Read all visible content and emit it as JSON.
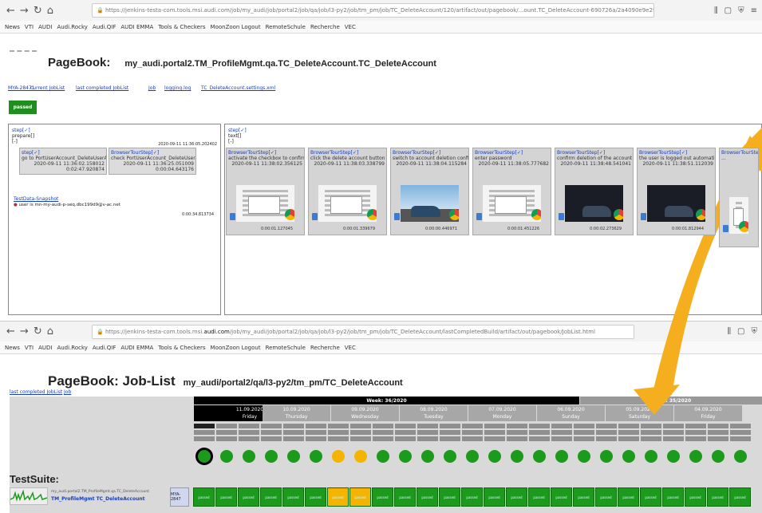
{
  "browser1": {
    "url": "https://jenkins-testa-com.tools.msi.audi.com/job/my_audi/job/portal2/job/qa/job/l3-py2/job/tm_pm/job/TC_DeleteAccount/120/artifact/out/pagebook/...ount.TC_DeleteAccount-690726a/2a4090e9e29a1"
  },
  "browser2": {
    "url_pre": "https://jenkins-testa-com.tools.msi.",
    "url_host": "audi.com",
    "url_post": "/job/my_audi/job/portal2/job/qa/job/l3-py2/job/tm_pm/job/TC_DeleteAccount/lastCompletedBuild/artifact/out/pagebook/JobList.html"
  },
  "bookmarks": [
    "News",
    "VTI",
    "AUDI",
    "Audi.Rocky",
    "Audi.QIF",
    "AUDI EMMA",
    "Tools & Checkers",
    "MoonZoon Logout",
    "RemoteSchule",
    "Recherche",
    "VEC"
  ],
  "page1": {
    "title": "PageBook:",
    "subtitle": "my_audi.portal2.TM_ProfileMgmt.qa.TC_DeleteAccount.TC_DeleteAccount",
    "links": [
      "MYA-28471",
      "current JobList",
      "last completed JobList",
      "Job",
      "logging.log",
      "TC_DeleteAccount.settings.xml"
    ],
    "status": "passed",
    "left": {
      "step": "step[✓]",
      "prepare": "prepare[]",
      "bracket": "[-]",
      "time": "2020-09-11 11:36:05.202402",
      "sub": [
        {
          "h": "step[✓]",
          "t": "go to PortUserAccount_DeleteUserAccount",
          "ts": "2020-09-11 11:36:02.158012",
          "d": "0:02:47.920874"
        },
        {
          "h": "BrowserTourStep[✓]",
          "t": "check PortUserAccount_DeleteUserAccount",
          "ts": "2020-09-11 11:36:25.051009",
          "d": "0:00:04.643176"
        }
      ],
      "testdata": "TestData-Snapshot",
      "user": "user is mn-my-audi-p-seq.dbc199d9@v-ac.net",
      "dur": "0:00:34.813734"
    },
    "right": {
      "step": "step[✓]",
      "text": "text[]",
      "bracket": "[-]",
      "cards": [
        {
          "h": "BrowserTourStep[✓]",
          "t": "activate the checkbox to confirm the deletion",
          "ts": "2020-09-11 11:38:02.356125",
          "d": "0:00:01.127045",
          "img": "page"
        },
        {
          "h": "BrowserTourStep[✓]",
          "t": "click the delete account button",
          "ts": "2020-09-11 11:38:03.338799",
          "d": "0:00:01.339679",
          "img": "page"
        },
        {
          "h": "BrowserTourStep[✓]",
          "t": "switch to account deletion confirmation tab",
          "ts": "2020-09-11 11:38:04.115284",
          "d": "0:00:00.446971",
          "img": "car"
        },
        {
          "h": "BrowserTourStep[✓]",
          "t": "enter password",
          "ts": "2020-09-11 11:38:05.777682",
          "d": "0:00:01.451226",
          "img": "page"
        },
        {
          "h": "BrowserTourStep[✓]",
          "t": "confirm deletion of the account",
          "ts": "2020-09-11 11:38:48.541041",
          "d": "0:00:02.273629",
          "img": "dark"
        },
        {
          "h": "BrowserTourStep[✓]",
          "t": "the user is logged out automatically",
          "ts": "2020-09-11 11:38:51.112039",
          "d": "0:00:01.812944",
          "img": "dark"
        },
        {
          "h": "BrowserTourStep[✓]",
          "t": "...",
          "ts": "",
          "d": "",
          "img": "page"
        }
      ]
    }
  },
  "page2": {
    "title": "PageBook: Job-List",
    "subtitle": "my_audi/portal2/qa/l3-py2/tm_pm/TC_DeleteAccount",
    "links": [
      "last completed JobList",
      "Job"
    ],
    "weeks": [
      {
        "label": "Week: 36/2020",
        "dark": true
      },
      {
        "label": "Week: 35/2020",
        "dark": false
      }
    ],
    "days": [
      {
        "date": "11.09.2020",
        "dow": "Friday",
        "active": true
      },
      {
        "date": "10.09.2020",
        "dow": "Thursday"
      },
      {
        "date": "09.09.2020",
        "dow": "Wednesday"
      },
      {
        "date": "08.09.2020",
        "dow": "Tuesday"
      },
      {
        "date": "07.09.2020",
        "dow": "Monday"
      },
      {
        "date": "06.09.2020",
        "dow": "Sunday"
      },
      {
        "date": "05.09.2020",
        "dow": "Saturday"
      },
      {
        "date": "04.09.2020",
        "dow": "Friday"
      }
    ],
    "suite": "TestSuite:",
    "testcase": {
      "path": "my_audi.portal2.TM_ProfileMgmt.qa.TC_DeleteAccount",
      "name": "TM_ProfileMgmt TC_DeleteAccount",
      "ticket": "MYA-2847",
      "result": "passed"
    },
    "runs": [
      "green",
      "green",
      "green",
      "green",
      "green",
      "green",
      "amber",
      "amber",
      "green",
      "green",
      "green",
      "green",
      "green",
      "green",
      "green",
      "green",
      "green",
      "green",
      "green",
      "green",
      "green",
      "green",
      "green",
      "green",
      "green"
    ],
    "colors": {
      "green": "#1c9a1c",
      "amber": "#f5b400"
    }
  },
  "arrow": {
    "color": "#f5ae1e"
  }
}
